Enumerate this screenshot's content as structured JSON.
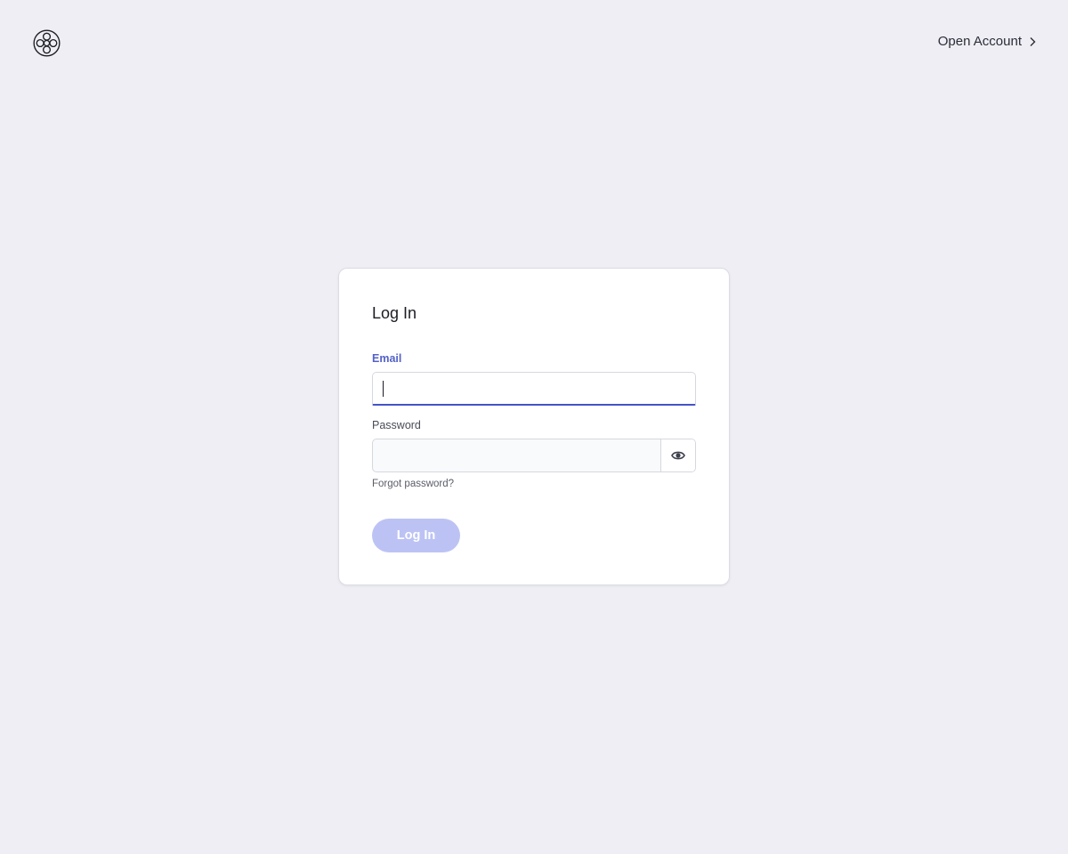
{
  "header": {
    "logo_icon": "ornamental-circle-logo-icon",
    "open_account_label": "Open Account",
    "open_account_icon": "chevron-right-icon"
  },
  "login_card": {
    "title": "Log In",
    "email": {
      "label": "Email",
      "value": "",
      "placeholder": ""
    },
    "password": {
      "label": "Password",
      "value": "",
      "placeholder": "",
      "toggle_icon": "eye-icon"
    },
    "forgot_password_label": "Forgot password?",
    "submit_label": "Log In"
  },
  "colors": {
    "background": "#eeeef4",
    "card": "#ffffff",
    "accent": "#4453c7",
    "email_label": "#5462c8",
    "button_disabled": "#bcc3f4"
  }
}
